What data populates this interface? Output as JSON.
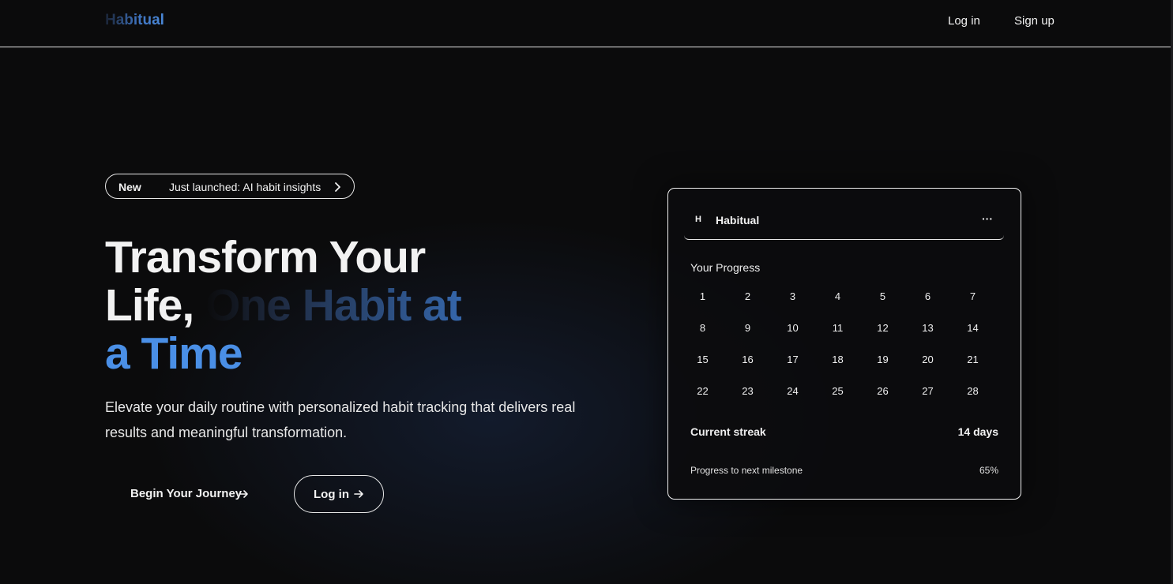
{
  "header": {
    "logo": "Habitual",
    "nav": {
      "login": "Log in",
      "signup": "Sign up"
    }
  },
  "badge": {
    "tag": "New",
    "text": "Just launched: AI habit insights",
    "icon": "chevron-right-icon"
  },
  "hero": {
    "headline_line1": "Transform Your",
    "headline_line2_a": "Life, ",
    "headline_line2_b": "One Habit at",
    "headline_line3": "a Time",
    "subtext": "Elevate your daily routine with personalized habit tracking that delivers real results and meaningful transformation.",
    "primary_cta": "Begin Your Journey",
    "secondary_cta": "Log in",
    "cta_icon": "arrow-right-icon"
  },
  "card": {
    "avatar": "H",
    "title": "Habitual",
    "more": "···",
    "progress_label": "Your Progress",
    "days": [
      "1",
      "2",
      "3",
      "4",
      "5",
      "6",
      "7",
      "8",
      "9",
      "10",
      "11",
      "12",
      "13",
      "14",
      "15",
      "16",
      "17",
      "18",
      "19",
      "20",
      "21",
      "22",
      "23",
      "24",
      "25",
      "26",
      "27",
      "28"
    ],
    "streak_label": "Current streak",
    "streak_value": "14 days",
    "milestone_label": "Progress to next milestone",
    "milestone_value": "65%"
  },
  "colors": {
    "background": "#0b0b0c",
    "accent_blue": "#4a8fe6",
    "text": "#f3f3f3"
  }
}
